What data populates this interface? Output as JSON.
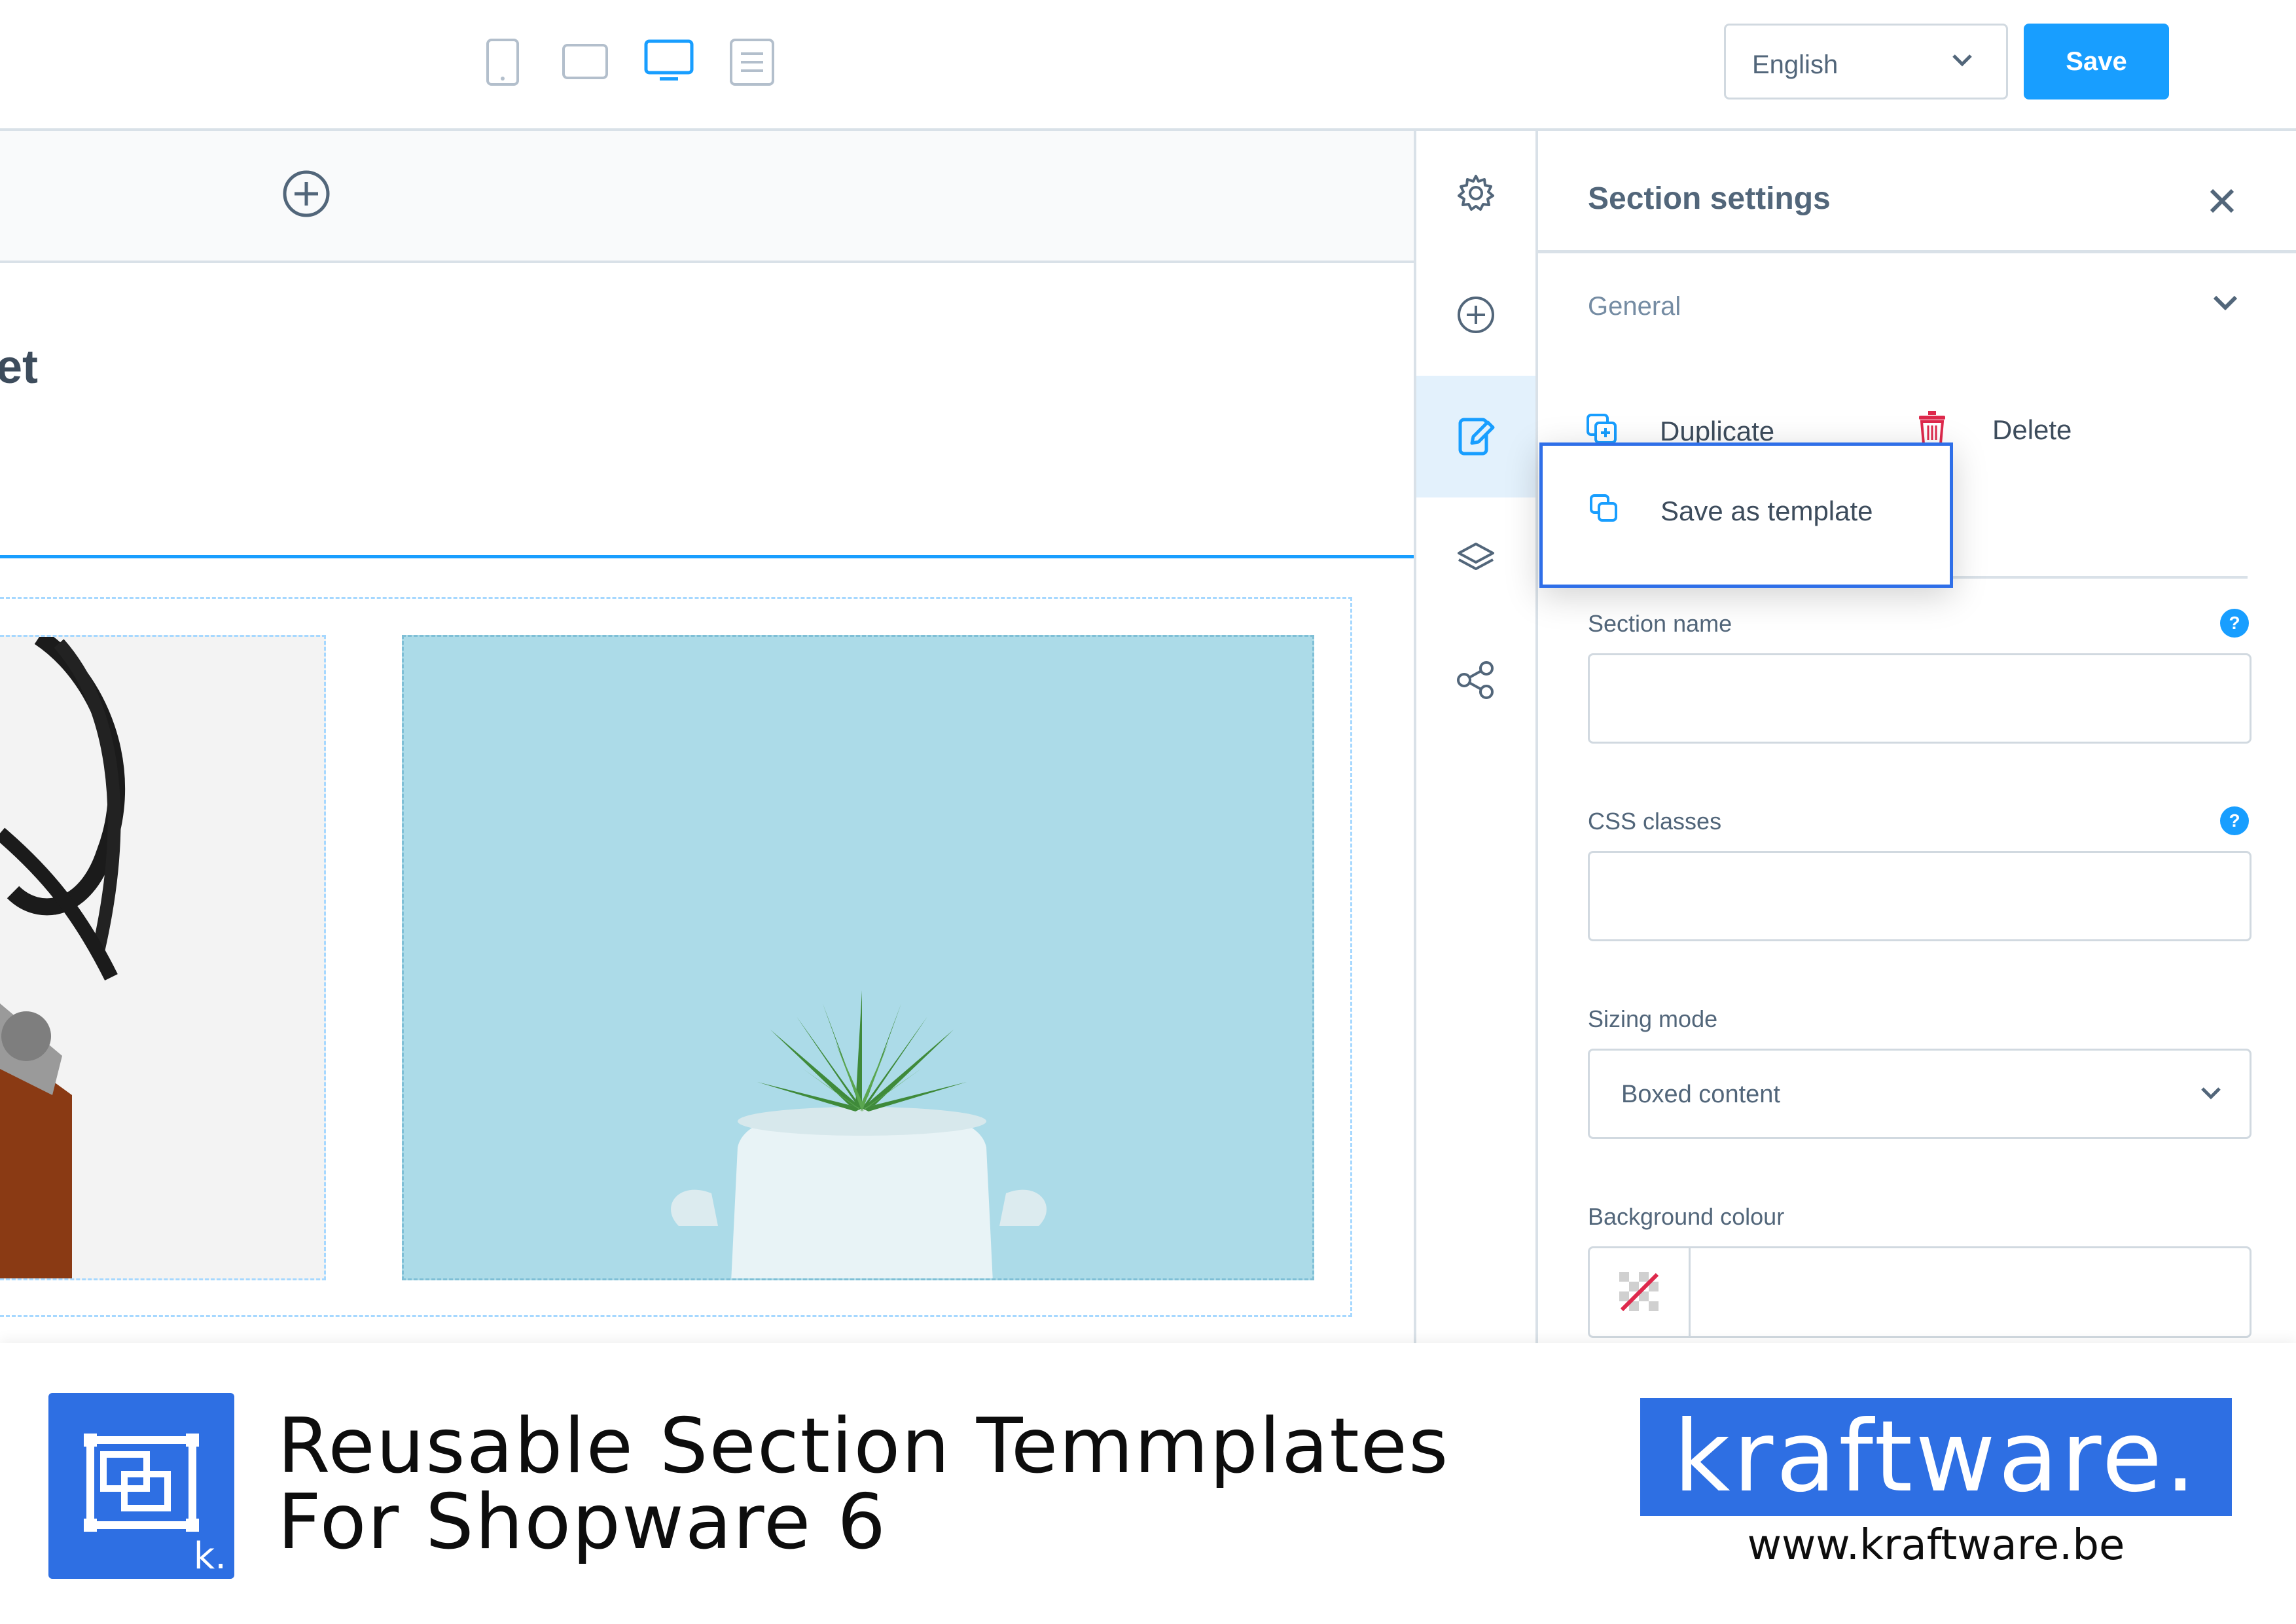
{
  "toolbar": {
    "device_views": [
      "mobile-view",
      "tablet-view",
      "desktop-view",
      "form-view"
    ],
    "active_device": "desktop-view",
    "language": "English",
    "save_label": "Save"
  },
  "canvas": {
    "heading_fragment": "et"
  },
  "sidebar": {
    "icons": [
      "gear-icon",
      "plus-circle-icon",
      "edit-icon",
      "layers-icon",
      "share-icon"
    ],
    "active_icon": "edit-icon"
  },
  "panel": {
    "title": "Section settings",
    "general_label": "General",
    "duplicate_label": "Duplicate",
    "delete_label": "Delete",
    "save_template_label": "Save as template",
    "section_name_label": "Section name",
    "section_name_value": "",
    "css_classes_label": "CSS classes",
    "css_classes_value": "",
    "sizing_mode_label": "Sizing mode",
    "sizing_mode_value": "Boxed content",
    "background_colour_label": "Background colour",
    "help_glyph": "?"
  },
  "footer": {
    "headline_line1": "Reusable Section Temmplates",
    "headline_line2": "For Shopware 6",
    "logo_letter": "k.",
    "brand": "kraftware.",
    "url": "www.kraftware.be"
  },
  "colors": {
    "accent": "#189eff",
    "highlight_border": "#2f6fe8",
    "brand_blue": "#2e6fe3",
    "delete_red": "#de294c"
  }
}
